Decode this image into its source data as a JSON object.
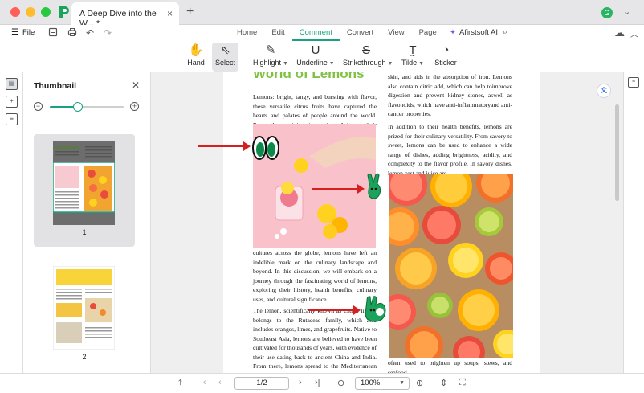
{
  "window": {
    "tab_title": "A Deep Dive into the W... *",
    "tab_close": "×",
    "new_tab": "+",
    "avatar_letter": "G"
  },
  "nav": {
    "file_label": "File",
    "tabs": [
      {
        "label": "Home",
        "active": false
      },
      {
        "label": "Edit",
        "active": false
      },
      {
        "label": "Comment",
        "active": true
      },
      {
        "label": "Convert",
        "active": false
      },
      {
        "label": "View",
        "active": false
      },
      {
        "label": "Page",
        "active": false
      }
    ],
    "ai_label": "Afirstsoft AI"
  },
  "toolbar": {
    "hand": "Hand",
    "select": "Select",
    "highlight": "Highlight",
    "underline": "Underline",
    "strikethrough": "Strikethrough",
    "tilde": "Tilde",
    "sticker": "Sticker"
  },
  "thumbnail": {
    "title": "Thumbnail",
    "zoom_level": 0.38,
    "pages": [
      "1",
      "2"
    ]
  },
  "document": {
    "heading": "World of Lemons",
    "col1_top": "Lemons: bright, tangy, and bursting with flavor, these versatile citrus fruits have captured the hearts and palates of people around the world. From their origins in ancient Asia to their widespread use in cuisines and",
    "col1_mid": "cultures across the globe, lemons have left an indelible mark on the culinary landscape and beyond. In this discussion, we will embark on a journey through the fascinating world of lemons, exploring their history, health benefits, culinary uses, and cultural significance.",
    "col1_bottom": "The lemon, scientifically known as Citrus limon, belongs to the Rutaceae family, which also includes oranges, limes, and grapefruits. Native to Southeast Asia, lemons are believed to have been cultivated for thousands of years, with evidence of their use dating back to ancient China and India. From there, lemons spread to the Mediterranean region, where they were",
    "col2_top": "skin, and aids in the absorption of iron. Lemons also contain citric add, which can help toimprove digestion and prevent kidney stones, aswell as flavonoids, which have anti-inflammatoryand anti-cancer properties.",
    "col2_mid": "In addition to their health benefits, lemons are prized for their culinary versatility. From savory to sweet, lemons can be used to enhance a wide range of dishes, adding brightness, acidity, and complexity to the flavor profile. In savory dishes, lemon zest and juice are",
    "col2_bottom": "often used to brighten up soups, stews, and seafood,"
  },
  "status": {
    "page_value": "1/2",
    "zoom_value": "100%"
  },
  "colors": {
    "accent": "#1aa184",
    "heading_green": "#7fc243",
    "arrow_red": "#d62020",
    "sticker_green": "#1aa35a"
  },
  "icons": {
    "hand": "hand-icon",
    "select": "cursor-arrow-icon",
    "highlight": "highlighter-pen-icon",
    "underline": "underline-icon",
    "strikethrough": "strikethrough-icon",
    "tilde": "tilde-text-icon",
    "sticker": "sticker-icon"
  }
}
